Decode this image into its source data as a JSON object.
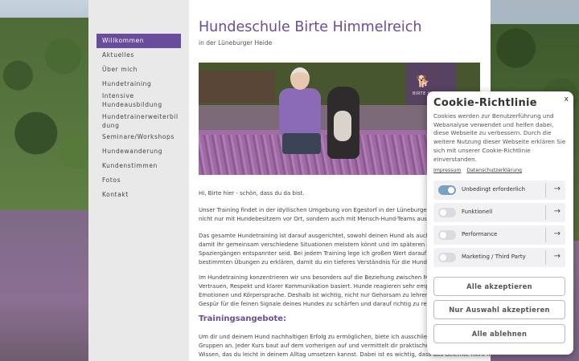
{
  "site": {
    "title": "Hundeschule Birte Himmelreich",
    "subtitle": "in der Lüneburger Heide",
    "nav": [
      {
        "label": "Willkommen",
        "active": true
      },
      {
        "label": "Aktuelles"
      },
      {
        "label": "Über mich"
      },
      {
        "label": "Hundetraining"
      },
      {
        "label": "Intensive Hundeausbildung"
      },
      {
        "label": "Hundetrainerweiterbildung"
      },
      {
        "label": "Seminare/Workshops"
      },
      {
        "label": "Hundewanderung"
      },
      {
        "label": "Kundenstimmen"
      },
      {
        "label": "Fotos"
      },
      {
        "label": "Kontakt"
      }
    ],
    "nav_lines": {
      "intensive_1": "Intensive",
      "intensive_2": "Hundeausbildung",
      "trainer_1": "Hundetrainerweiterbil",
      "trainer_2": "dung"
    },
    "hero_logo_text": "BIRTE H",
    "body": {
      "greeting": "Hi, Birte hier - schön, dass du da bist.",
      "p1_l1": "Unser Training findet in der idyllischen Umgebung von Egestorf in der Lüneburger Heide",
      "p1_l2": "nicht nur mit Hundebesitzern vor Ort, sondern auch mit Mensch-Hund-Teams aus ganz",
      "p2_l1": "Das gesamte Hundetraining ist darauf ausgerichtet, sowohl deinen Hund als auch dich",
      "p2_l2": "damit ihr gemeinsam verschiedene Situationen meistern könnt und im späteren Alltag",
      "p2_l3": "Spaziergängen entspannter seid. Bei jedem Training lege ich großen Wert darauf, dir die",
      "p2_l4": "bestimmten Übungen zu erklären, damit du ein tieferes Verständnis für die Hundeerzie",
      "p3_l1": "Im Hundetraining konzentrieren wir uns besonders auf die Beziehung zwischen Mensch",
      "p3_l2": "Vertrauen, Respekt und klarer Kommunikation basiert. Hunde reagieren sehr empfinds",
      "p3_l3": "Emotionen und Körpersprache. Deshalb ist wichtig, nicht nur Gehorsam zu lehren, sond",
      "p3_l4": "Gespür für die feinen Signale deines Hundes zu schärfen und darauf richtig zu reagiere",
      "h2": "Trainingsangebote:",
      "p4_l1": "Um dir und deinem Hund nachhaltigen Erfolg zu ermöglichen, biete ich ausschließlich K",
      "p4_l2": "Gruppen an. Jeder Kurs baut auf dem vorherigen auf und vermittelt dir praktisches, so",
      "p4_l3": "Wissen, das du leicht in deinem Alltag umsetzen kannst. Dabei ist es wichtig, dass das Gelernte nicht nur"
    }
  },
  "cookie": {
    "title": "Cookie-Richtlinie",
    "close": "x",
    "description": "Cookies werden zur Benutzerführung und Webanalyse verwendet und helfen dabei, diese Webseite zu verbessern. Durch die weitere Nutzung dieser Webseite erklären Sie sich mit unserer Cookie-Richtlinie einverstanden.",
    "links": {
      "impressum": "Impressum",
      "datenschutz": "Datenschutzerklärung"
    },
    "options": [
      {
        "label": "Unbedingt erforderlich",
        "enabled": true
      },
      {
        "label": "Funktionell",
        "enabled": false
      },
      {
        "label": "Performance",
        "enabled": false
      },
      {
        "label": "Marketing / Third Party",
        "enabled": false
      }
    ],
    "arrow": "→",
    "buttons": {
      "accept_all": "Alle akzeptieren",
      "accept_selection": "Nur Auswahl akzeptieren",
      "reject_all": "Alle ablehnen"
    }
  },
  "colors": {
    "accent": "#6a4c9c",
    "toggle_on": "#7aa0c2"
  }
}
